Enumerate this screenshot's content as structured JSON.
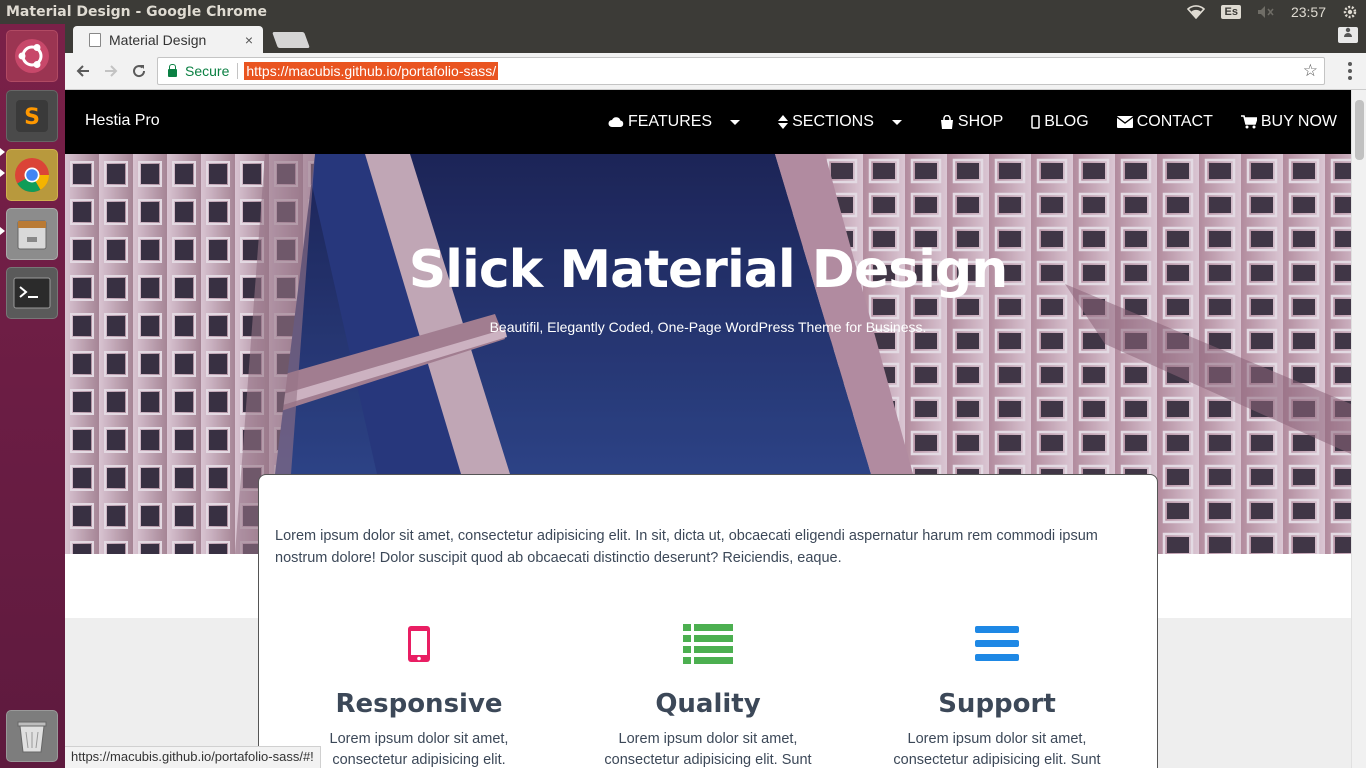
{
  "os": {
    "window_title": "Material Design - Google Chrome",
    "keyboard_layout": "Es",
    "clock": "23:57"
  },
  "launcher": {
    "items": [
      {
        "name": "ubuntu-dash",
        "icon": "ubuntu-logo-icon"
      },
      {
        "name": "sublime-text",
        "icon": "sublime-icon"
      },
      {
        "name": "google-chrome",
        "icon": "chrome-icon"
      },
      {
        "name": "files",
        "icon": "file-cabinet-icon"
      },
      {
        "name": "terminal",
        "icon": "terminal-icon"
      },
      {
        "name": "trash",
        "icon": "trash-icon"
      }
    ]
  },
  "browser": {
    "tab_title": "Material Design",
    "tab_close": "×",
    "secure_label": "Secure",
    "url": "https://macubis.github.io/portafolio-sass/",
    "status_url": "https://macubis.github.io/portafolio-sass/#!"
  },
  "site": {
    "brand": "Hestia Pro",
    "menu": [
      {
        "label": "FEATURES",
        "icon": "cloud-icon"
      },
      {
        "label": "SECTIONS",
        "icon": "sort-icon"
      },
      {
        "label": "SHOP",
        "icon": "shopping-bag-icon"
      },
      {
        "label": "BLOG",
        "icon": "mobile-icon"
      },
      {
        "label": "CONTACT",
        "icon": "envelope-icon"
      },
      {
        "label": "BUY NOW",
        "icon": "cart-icon"
      }
    ],
    "hero": {
      "title": "Slick Material Design",
      "subtitle": "Beautifil, Elegantly Coded, One-Page WordPress Theme for Business."
    },
    "intro": "Lorem ipsum dolor sit amet, consectetur adipisicing elit. In sit, dicta ut, obcaecati eligendi aspernatur harum rem commodi ipsum nostrum dolore! Dolor suscipit quod ab obcaecati distinctio deserunt? Reiciendis, eaque.",
    "features": [
      {
        "title": "Responsive",
        "text": "Lorem ipsum dolor sit amet, consectetur adipisicing elit. Veritatis",
        "color": "#e91e63",
        "icon": "phone-icon"
      },
      {
        "title": "Quality",
        "text": "Lorem ipsum dolor sit amet, consectetur adipisicing elit. Sunt",
        "color": "#4caf50",
        "icon": "list-icon"
      },
      {
        "title": "Support",
        "text": "Lorem ipsum dolor sit amet, consectetur adipisicing elit. Sunt",
        "color": "#1e88e5",
        "icon": "bars-icon"
      }
    ]
  }
}
